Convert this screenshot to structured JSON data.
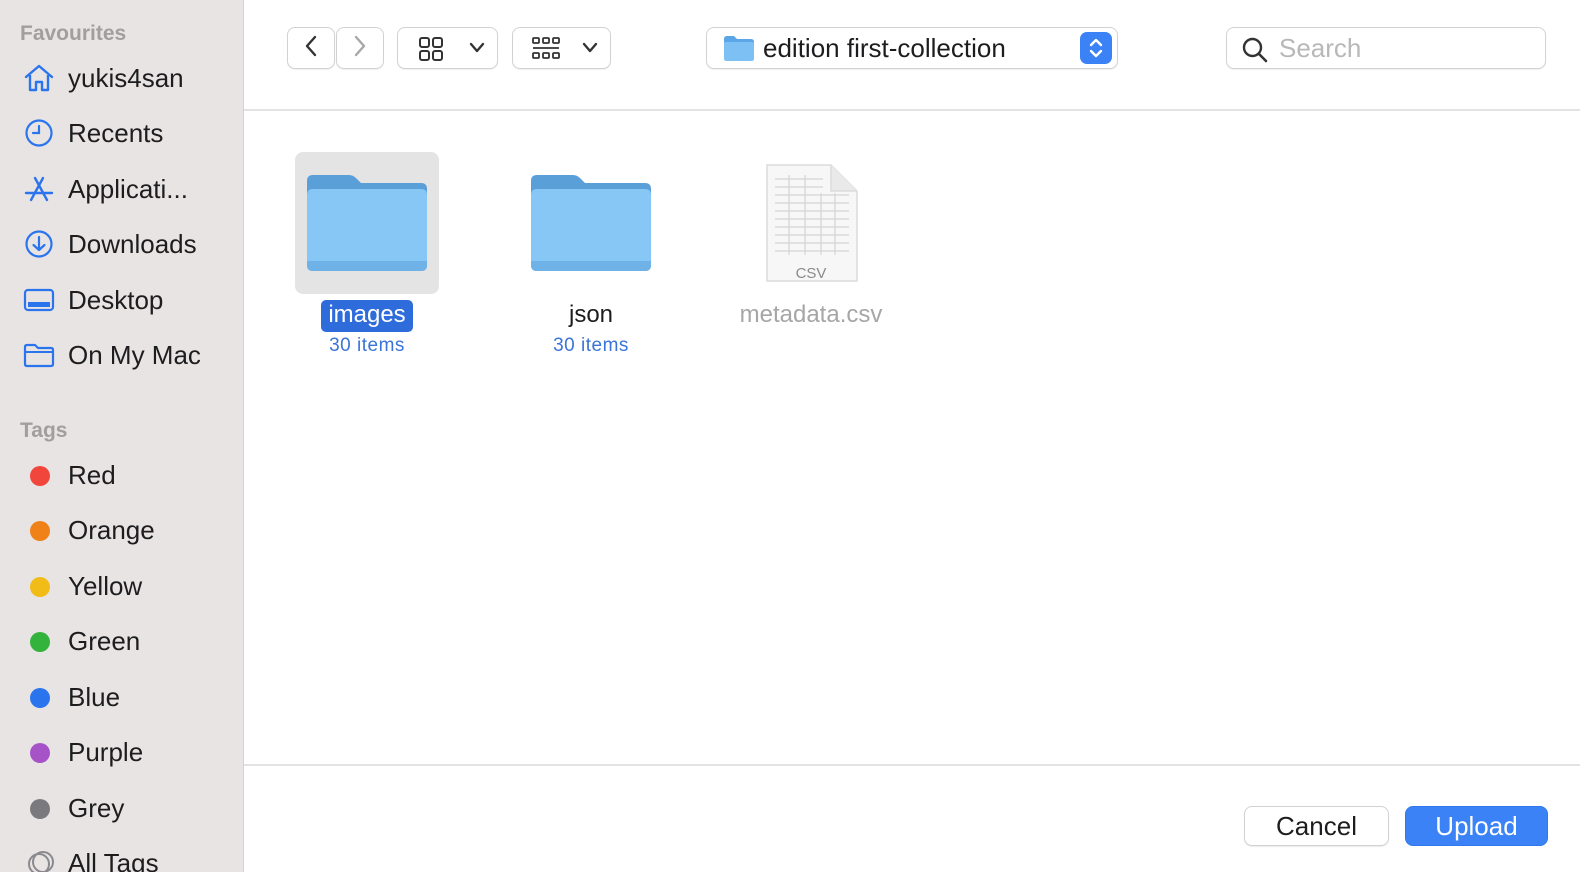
{
  "sidebar": {
    "favourites_heading": "Favourites",
    "favourites": [
      {
        "label": "yukis4san",
        "icon": "home-icon"
      },
      {
        "label": "Recents",
        "icon": "clock-icon"
      },
      {
        "label": "Applicati...",
        "icon": "applications-icon"
      },
      {
        "label": "Downloads",
        "icon": "download-icon"
      },
      {
        "label": "Desktop",
        "icon": "desktop-icon"
      },
      {
        "label": "On My Mac",
        "icon": "folder-icon"
      }
    ],
    "tags_heading": "Tags",
    "tags": [
      {
        "label": "Red",
        "color": "#f0463c"
      },
      {
        "label": "Orange",
        "color": "#f08018"
      },
      {
        "label": "Yellow",
        "color": "#f2bc18"
      },
      {
        "label": "Green",
        "color": "#34b33c"
      },
      {
        "label": "Blue",
        "color": "#2a74ee"
      },
      {
        "label": "Purple",
        "color": "#a753c8"
      },
      {
        "label": "Grey",
        "color": "#7a7a7e"
      },
      {
        "label": "All Tags",
        "icon": "all-tags-icon"
      }
    ],
    "accent_color": "#2a74ee"
  },
  "toolbar": {
    "current_folder": "edition first-collection",
    "search_placeholder": "Search",
    "search_value": ""
  },
  "files": [
    {
      "name": "images",
      "meta": "30 items",
      "kind": "folder",
      "selected": true
    },
    {
      "name": "json",
      "meta": "30 items",
      "kind": "folder",
      "selected": false
    },
    {
      "name": "metadata.csv",
      "meta": "",
      "kind": "csv-file",
      "selected": false,
      "badge": "CSV"
    }
  ],
  "footer": {
    "cancel_label": "Cancel",
    "upload_label": "Upload"
  }
}
